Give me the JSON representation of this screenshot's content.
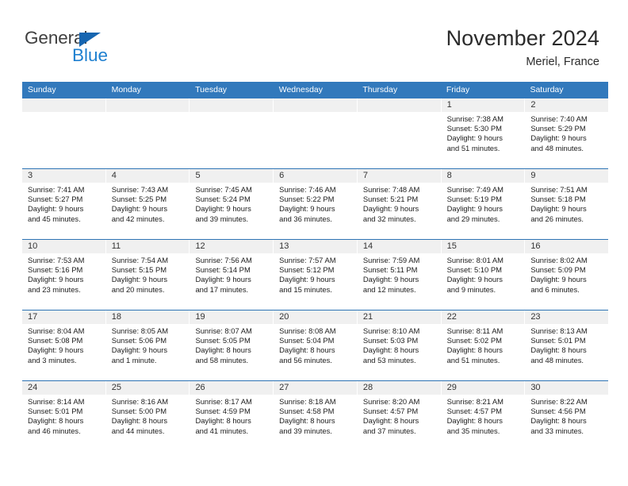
{
  "brand": {
    "word_one": "General",
    "word_two": "Blue",
    "triangle_color": "#1665b0",
    "blue_text_color": "#1f80d0"
  },
  "header": {
    "title": "November 2024",
    "location": "Meriel, France",
    "accent_color": "#3279bc",
    "daynum_band_color": "#f0f0f0"
  },
  "weekdays": [
    "Sunday",
    "Monday",
    "Tuesday",
    "Wednesday",
    "Thursday",
    "Friday",
    "Saturday"
  ],
  "weeks": [
    [
      {
        "day": "",
        "info": ""
      },
      {
        "day": "",
        "info": ""
      },
      {
        "day": "",
        "info": ""
      },
      {
        "day": "",
        "info": ""
      },
      {
        "day": "",
        "info": ""
      },
      {
        "day": "1",
        "info": "Sunrise: 7:38 AM\nSunset: 5:30 PM\nDaylight: 9 hours\nand 51 minutes."
      },
      {
        "day": "2",
        "info": "Sunrise: 7:40 AM\nSunset: 5:29 PM\nDaylight: 9 hours\nand 48 minutes."
      }
    ],
    [
      {
        "day": "3",
        "info": "Sunrise: 7:41 AM\nSunset: 5:27 PM\nDaylight: 9 hours\nand 45 minutes."
      },
      {
        "day": "4",
        "info": "Sunrise: 7:43 AM\nSunset: 5:25 PM\nDaylight: 9 hours\nand 42 minutes."
      },
      {
        "day": "5",
        "info": "Sunrise: 7:45 AM\nSunset: 5:24 PM\nDaylight: 9 hours\nand 39 minutes."
      },
      {
        "day": "6",
        "info": "Sunrise: 7:46 AM\nSunset: 5:22 PM\nDaylight: 9 hours\nand 36 minutes."
      },
      {
        "day": "7",
        "info": "Sunrise: 7:48 AM\nSunset: 5:21 PM\nDaylight: 9 hours\nand 32 minutes."
      },
      {
        "day": "8",
        "info": "Sunrise: 7:49 AM\nSunset: 5:19 PM\nDaylight: 9 hours\nand 29 minutes."
      },
      {
        "day": "9",
        "info": "Sunrise: 7:51 AM\nSunset: 5:18 PM\nDaylight: 9 hours\nand 26 minutes."
      }
    ],
    [
      {
        "day": "10",
        "info": "Sunrise: 7:53 AM\nSunset: 5:16 PM\nDaylight: 9 hours\nand 23 minutes."
      },
      {
        "day": "11",
        "info": "Sunrise: 7:54 AM\nSunset: 5:15 PM\nDaylight: 9 hours\nand 20 minutes."
      },
      {
        "day": "12",
        "info": "Sunrise: 7:56 AM\nSunset: 5:14 PM\nDaylight: 9 hours\nand 17 minutes."
      },
      {
        "day": "13",
        "info": "Sunrise: 7:57 AM\nSunset: 5:12 PM\nDaylight: 9 hours\nand 15 minutes."
      },
      {
        "day": "14",
        "info": "Sunrise: 7:59 AM\nSunset: 5:11 PM\nDaylight: 9 hours\nand 12 minutes."
      },
      {
        "day": "15",
        "info": "Sunrise: 8:01 AM\nSunset: 5:10 PM\nDaylight: 9 hours\nand 9 minutes."
      },
      {
        "day": "16",
        "info": "Sunrise: 8:02 AM\nSunset: 5:09 PM\nDaylight: 9 hours\nand 6 minutes."
      }
    ],
    [
      {
        "day": "17",
        "info": "Sunrise: 8:04 AM\nSunset: 5:08 PM\nDaylight: 9 hours\nand 3 minutes."
      },
      {
        "day": "18",
        "info": "Sunrise: 8:05 AM\nSunset: 5:06 PM\nDaylight: 9 hours\nand 1 minute."
      },
      {
        "day": "19",
        "info": "Sunrise: 8:07 AM\nSunset: 5:05 PM\nDaylight: 8 hours\nand 58 minutes."
      },
      {
        "day": "20",
        "info": "Sunrise: 8:08 AM\nSunset: 5:04 PM\nDaylight: 8 hours\nand 56 minutes."
      },
      {
        "day": "21",
        "info": "Sunrise: 8:10 AM\nSunset: 5:03 PM\nDaylight: 8 hours\nand 53 minutes."
      },
      {
        "day": "22",
        "info": "Sunrise: 8:11 AM\nSunset: 5:02 PM\nDaylight: 8 hours\nand 51 minutes."
      },
      {
        "day": "23",
        "info": "Sunrise: 8:13 AM\nSunset: 5:01 PM\nDaylight: 8 hours\nand 48 minutes."
      }
    ],
    [
      {
        "day": "24",
        "info": "Sunrise: 8:14 AM\nSunset: 5:01 PM\nDaylight: 8 hours\nand 46 minutes."
      },
      {
        "day": "25",
        "info": "Sunrise: 8:16 AM\nSunset: 5:00 PM\nDaylight: 8 hours\nand 44 minutes."
      },
      {
        "day": "26",
        "info": "Sunrise: 8:17 AM\nSunset: 4:59 PM\nDaylight: 8 hours\nand 41 minutes."
      },
      {
        "day": "27",
        "info": "Sunrise: 8:18 AM\nSunset: 4:58 PM\nDaylight: 8 hours\nand 39 minutes."
      },
      {
        "day": "28",
        "info": "Sunrise: 8:20 AM\nSunset: 4:57 PM\nDaylight: 8 hours\nand 37 minutes."
      },
      {
        "day": "29",
        "info": "Sunrise: 8:21 AM\nSunset: 4:57 PM\nDaylight: 8 hours\nand 35 minutes."
      },
      {
        "day": "30",
        "info": "Sunrise: 8:22 AM\nSunset: 4:56 PM\nDaylight: 8 hours\nand 33 minutes."
      }
    ]
  ]
}
